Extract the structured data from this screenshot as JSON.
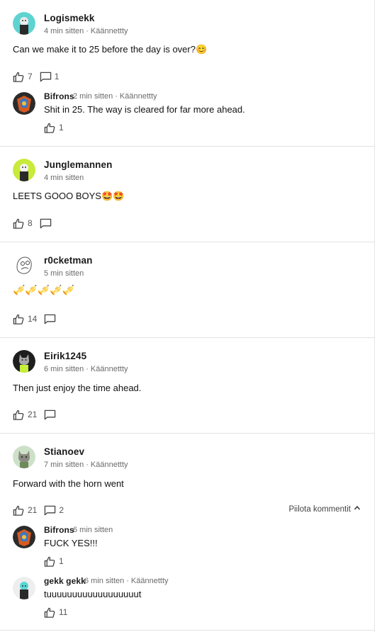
{
  "dot": "·",
  "posts": [
    {
      "author": "Logismekk",
      "time": "4 min sitten",
      "translated": "Käännettty",
      "text": "Can we make it to 25 before the day is over?😊",
      "likes": "7",
      "comments": "1",
      "replies": [
        {
          "author": "Bifrons",
          "time": "2 min sitten",
          "translated": "Käännettty",
          "text": "Shit in 25. The way is cleared for far more ahead.",
          "likes": "1"
        }
      ]
    },
    {
      "author": "Junglemannen",
      "time": "4 min sitten",
      "text": "LEETS GOOO BOYS🤩🤩",
      "likes": "8"
    },
    {
      "author": "r0cketman",
      "time": "5 min sitten",
      "text": "🎺🎺🎺🎺🎺",
      "likes": "14"
    },
    {
      "author": "Eirik1245",
      "time": "6 min sitten",
      "translated": "Käännettty",
      "text": "Then just enjoy the time ahead.",
      "likes": "21"
    },
    {
      "author": "Stianoev",
      "time": "7 min sitten",
      "translated": "Käännettty",
      "text": "Forward with the horn went",
      "likes": "21",
      "comments": "2",
      "hide_comments": "Piilota kommentit",
      "replies": [
        {
          "author": "Bifrons",
          "time": "6 min sitten",
          "text": "FUCK YES!!!",
          "likes": "1"
        },
        {
          "author": "gekk gekk",
          "time": "6 min sitten",
          "translated": "Käännettty",
          "text": "tuuuuuuuuuuuuuuuuuut",
          "likes": "11"
        }
      ]
    }
  ]
}
